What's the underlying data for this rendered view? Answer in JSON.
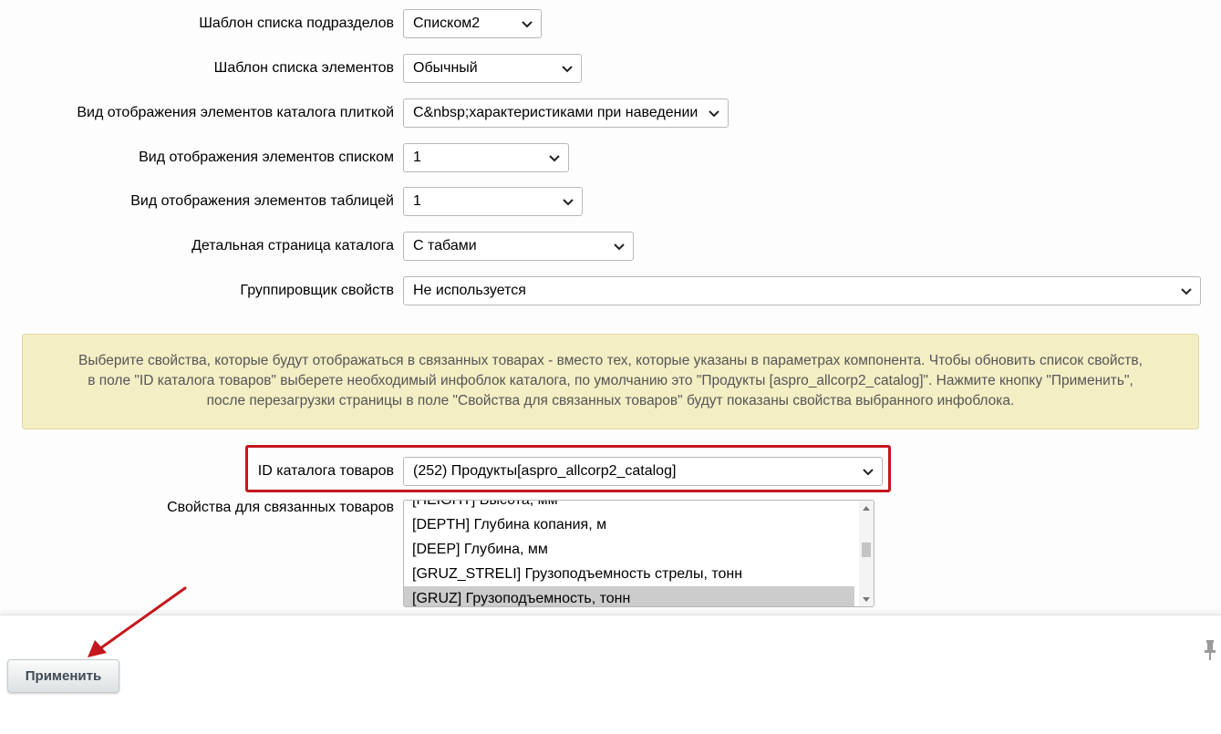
{
  "fields": [
    {
      "label": "Шаблон списка подразделов",
      "value": "Списком2"
    },
    {
      "label": "Шаблон списка элементов",
      "value": "Обычный"
    },
    {
      "label": "Вид отображения элементов каталога плиткой",
      "value": "C&nbsp;характеристиками при наведении"
    },
    {
      "label": "Вид отображения элементов списком",
      "value": "1"
    },
    {
      "label": "Вид отображения элементов таблицей",
      "value": "1"
    },
    {
      "label": "Детальная страница каталога",
      "value": "С табами"
    },
    {
      "label": "Группировщик свойств",
      "value": "Не используется"
    }
  ],
  "info_text": {
    "line1": "Выберите свойства, которые будут отображаться в связанных товарах - вместо тех, которые указаны в параметрах компонента. Чтобы обновить список свойств,",
    "line2": "в поле \"ID каталога товаров\" выберете необходимый инфоблок каталога, по умолчанию это \"Продукты [aspro_allcorp2_catalog]\". Нажмите кнопку \"Применить\",",
    "line3": "после перезагрузки страницы в поле \"Свойства для связанных товаров\" будут показаны свойства выбранного инфоблока."
  },
  "catalog_id": {
    "label": "ID каталога товаров",
    "value": "(252) Продукты[aspro_allcorp2_catalog]"
  },
  "related_props": {
    "label": "Свойства для связанных товаров",
    "items": [
      "[HEIGHT] Высота, мм",
      "[DEPTH] Глубина копания, м",
      "[DEEP] Глубина, мм",
      "[GRUZ_STRELI] Грузоподъемность стрелы, тонн",
      "[GRUZ] Грузоподъемность, тонн"
    ]
  },
  "footer": {
    "apply_label": "Применить"
  },
  "colors": {
    "highlight": "#c4171d",
    "arrow": "#c4171d",
    "info_bg": "#f4eec5"
  },
  "icons": {
    "dropdown": "chevron-down-icon",
    "pin": "pin-icon",
    "pointer": "arrow-annotation"
  }
}
